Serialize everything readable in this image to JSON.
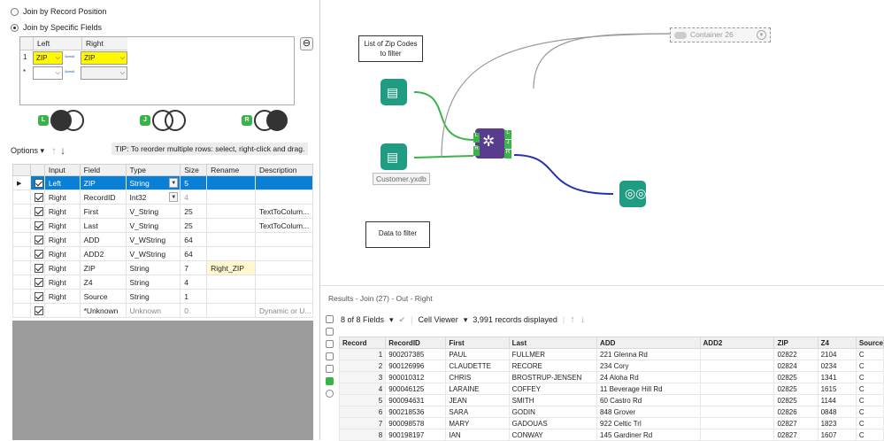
{
  "join": {
    "opt_position": "Join by Record Position",
    "opt_fields": "Join by Specific Fields",
    "col_left": "Left",
    "col_right": "Right",
    "row1_num": "1",
    "row1_left": "ZIP",
    "row1_right": "ZIP",
    "row2_num": "*",
    "badge_l": "L",
    "badge_j": "J",
    "badge_r": "R",
    "minus": "⊖"
  },
  "options": {
    "label": "Options",
    "tip": "TIP: To reorder multiple rows: select, right-click and drag."
  },
  "fields": {
    "headers": [
      "",
      "Input",
      "Field",
      "Type",
      "Size",
      "Rename",
      "Description"
    ],
    "rows": [
      {
        "input": "Left",
        "field": "ZIP",
        "type": "String",
        "size": "5",
        "rename": "",
        "desc": ""
      },
      {
        "input": "Right",
        "field": "RecordID",
        "type": "Int32",
        "size": "4",
        "rename": "",
        "desc": ""
      },
      {
        "input": "Right",
        "field": "First",
        "type": "V_String",
        "size": "25",
        "rename": "",
        "desc": "TextToColum..."
      },
      {
        "input": "Right",
        "field": "Last",
        "type": "V_String",
        "size": "25",
        "rename": "",
        "desc": "TextToColum..."
      },
      {
        "input": "Right",
        "field": "ADD",
        "type": "V_WString",
        "size": "64",
        "rename": "",
        "desc": ""
      },
      {
        "input": "Right",
        "field": "ADD2",
        "type": "V_WString",
        "size": "64",
        "rename": "",
        "desc": ""
      },
      {
        "input": "Right",
        "field": "ZIP",
        "type": "String",
        "size": "7",
        "rename": "Right_ZIP",
        "desc": ""
      },
      {
        "input": "Right",
        "field": "Z4",
        "type": "String",
        "size": "4",
        "rename": "",
        "desc": ""
      },
      {
        "input": "Right",
        "field": "Source",
        "type": "String",
        "size": "1",
        "rename": "",
        "desc": ""
      },
      {
        "input": "",
        "field": "*Unknown",
        "type": "Unknown",
        "size": "0",
        "rename": "",
        "desc": "Dynamic or U..."
      }
    ]
  },
  "canvas": {
    "note_zip": "List of Zip Codes to filter",
    "container": "Container 26",
    "file_label": "Customer.yxdb",
    "note_data": "Data to filter",
    "join_anchors": [
      "L",
      "R",
      "L",
      "J",
      "R"
    ]
  },
  "results": {
    "title": "Results - Join (27) - Out - Right",
    "fields_count": "8 of 8 Fields",
    "viewer": "Cell Viewer",
    "records": "3,991 records displayed",
    "headers": [
      "Record",
      "RecordID",
      "First",
      "Last",
      "ADD",
      "ADD2",
      "ZIP",
      "Z4",
      "Source"
    ],
    "rows": [
      [
        "1",
        "900207385",
        "PAUL",
        "FULLMER",
        "221 Glenna Rd",
        "",
        "02822",
        "2104",
        "C"
      ],
      [
        "2",
        "900126996",
        "CLAUDETTE",
        "RECORE",
        "234 Cory",
        "",
        "02824",
        "0234",
        "C"
      ],
      [
        "3",
        "900010312",
        "CHRIS",
        "BROSTRUP-JENSEN",
        "24 Aloha Rd",
        "",
        "02825",
        "1341",
        "C"
      ],
      [
        "4",
        "900046125",
        "LARAINE",
        "COFFEY",
        "11 Beverage Hill Rd",
        "",
        "02825",
        "1615",
        "C"
      ],
      [
        "5",
        "900094631",
        "JEAN",
        "SMITH",
        "60 Castro Rd",
        "",
        "02825",
        "1144",
        "C"
      ],
      [
        "6",
        "900218536",
        "SARA",
        "GODIN",
        "848 Grover",
        "",
        "02826",
        "0848",
        "C"
      ],
      [
        "7",
        "900098578",
        "MARY",
        "GADOUAS",
        "922 Celtic Trl",
        "",
        "02827",
        "1823",
        "C"
      ],
      [
        "8",
        "900198197",
        "IAN",
        "CONWAY",
        "145 Gardiner Rd",
        "",
        "02827",
        "1607",
        "C"
      ]
    ]
  },
  "colors": {
    "accent": "#0a7fd6",
    "highlight": "#fff800",
    "tool_green": "#1f9c82",
    "join_purple": "#5a3c8e",
    "anchor_green": "#3bb34a"
  }
}
